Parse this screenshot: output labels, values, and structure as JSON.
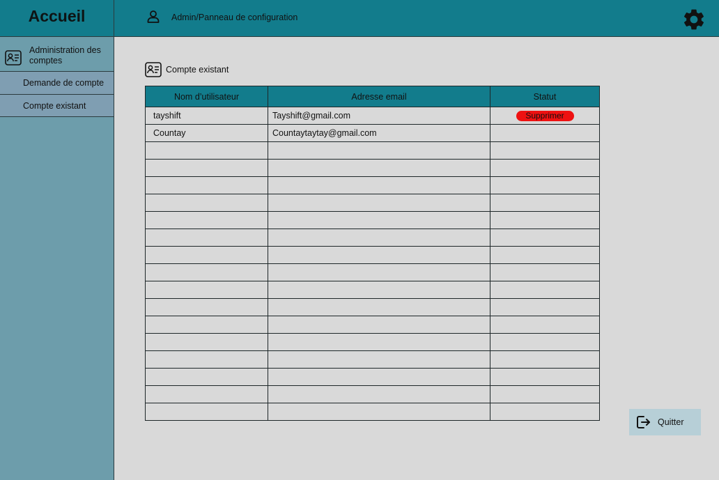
{
  "header": {
    "brand": "Accueil",
    "breadcrumb": "Admin/Panneau de configuration"
  },
  "sidebar": {
    "section_label": "Administration des comptes",
    "items": [
      {
        "label": "Demande de compte"
      },
      {
        "label": "Compte existant"
      }
    ]
  },
  "main": {
    "section_title": "Compte existant",
    "table": {
      "columns": [
        "Nom d’utilisateur",
        "Adresse email",
        "Statut"
      ],
      "rows": [
        {
          "username": "tayshift",
          "email": "Tayshift@gmail.com",
          "status": "Supprimer"
        },
        {
          "username": "Countay",
          "email": "Countaytaytay@gmail.com",
          "status": ""
        },
        {
          "username": "",
          "email": "",
          "status": ""
        },
        {
          "username": "",
          "email": "",
          "status": ""
        },
        {
          "username": "",
          "email": "",
          "status": ""
        },
        {
          "username": "",
          "email": "",
          "status": ""
        },
        {
          "username": "",
          "email": "",
          "status": ""
        },
        {
          "username": "",
          "email": "",
          "status": ""
        },
        {
          "username": "",
          "email": "",
          "status": ""
        },
        {
          "username": "",
          "email": "",
          "status": ""
        },
        {
          "username": "",
          "email": "",
          "status": ""
        },
        {
          "username": "",
          "email": "",
          "status": ""
        },
        {
          "username": "",
          "email": "",
          "status": ""
        },
        {
          "username": "",
          "email": "",
          "status": ""
        },
        {
          "username": "",
          "email": "",
          "status": ""
        },
        {
          "username": "",
          "email": "",
          "status": ""
        },
        {
          "username": "",
          "email": "",
          "status": ""
        },
        {
          "username": "",
          "email": "",
          "status": ""
        }
      ]
    },
    "quit_label": "Quitter"
  },
  "icons": {
    "user": "user-icon",
    "settings": "gear-icon",
    "account_card": "id-card-icon",
    "exit": "logout-icon"
  },
  "colors": {
    "header": "#127c8c",
    "sidebar": "#6d9dab",
    "sidebar_item": "#7f9eb2",
    "delete_button": "#ee1111",
    "quit_button": "#b7cfd7"
  }
}
